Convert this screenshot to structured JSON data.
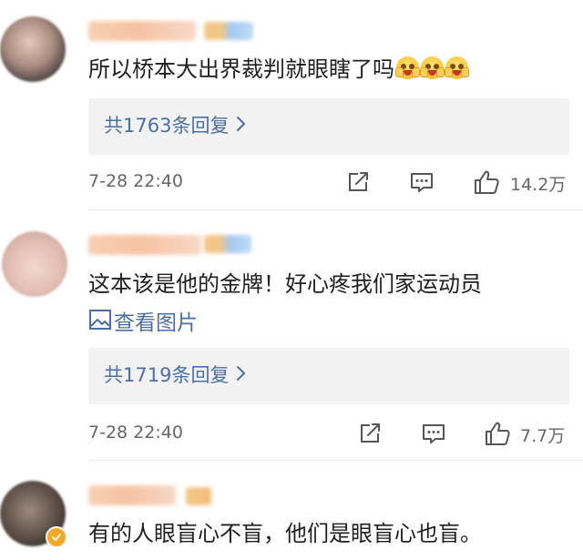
{
  "comments": [
    {
      "text": "所以桥本大出界裁判就眼瞎了吗",
      "emoji": [
        "grimacing-face-emoji",
        "grimacing-face-emoji",
        "grimacing-face-emoji"
      ],
      "view_image_label": "",
      "reply_label": "共1763条回复",
      "time": "7-28 22:40",
      "likes": "14.2万"
    },
    {
      "text": "这本该是他的金牌！好心疼我们家运动员",
      "emoji": [],
      "view_image_label": "查看图片",
      "reply_label": "共1719条回复",
      "time": "7-28 22:40",
      "likes": "7.7万"
    },
    {
      "text": "有的人眼盲心不盲，他们是眼盲心也盲。",
      "emoji": [],
      "view_image_label": "",
      "reply_label": "",
      "time": "",
      "likes": ""
    }
  ],
  "colors": {
    "link": "#4a6fa8",
    "reply_bg": "#f2f2f2",
    "meta_text": "#666666",
    "badge_orange": "#f5a623"
  },
  "icons": {
    "share": "share-icon",
    "comment": "comment-icon",
    "like": "like-icon",
    "chevron": "chevron-right-icon",
    "image": "image-icon"
  }
}
